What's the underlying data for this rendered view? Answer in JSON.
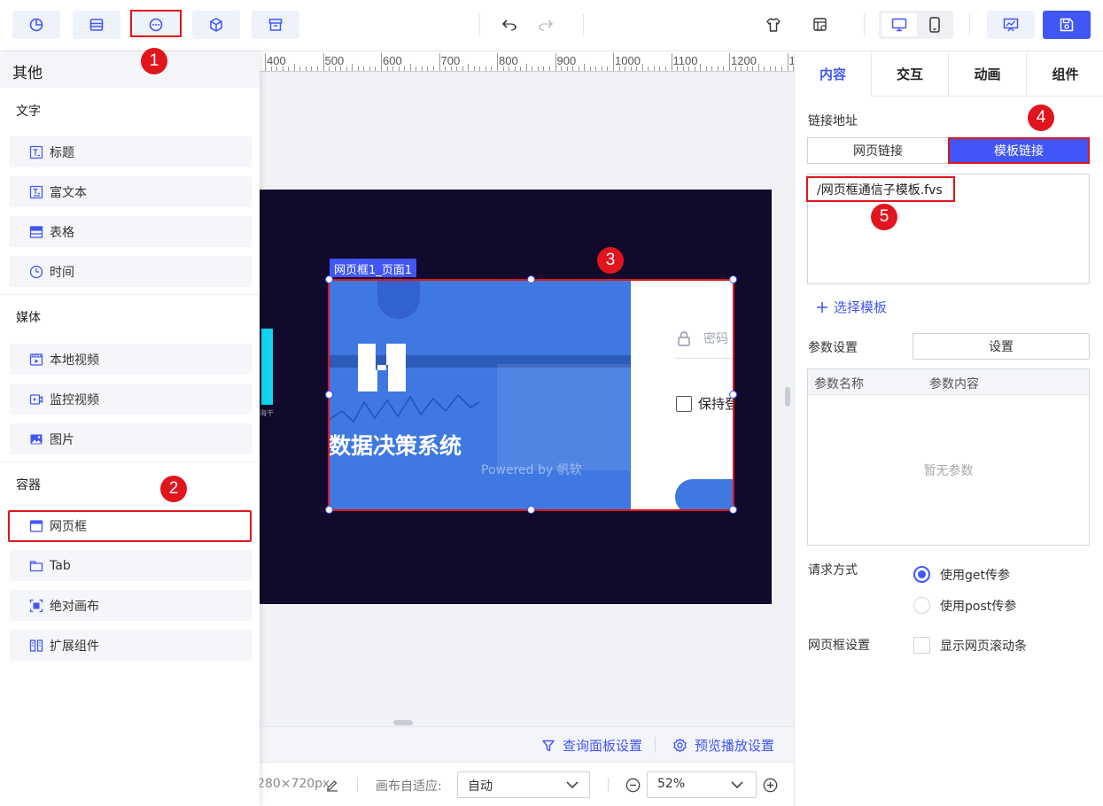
{
  "annotations": [
    "1",
    "2",
    "3",
    "4",
    "5"
  ],
  "left_panel": {
    "title": "其他",
    "sections": [
      {
        "title": "文字",
        "items": [
          "标题",
          "富文本",
          "表格",
          "时间"
        ]
      },
      {
        "title": "媒体",
        "items": [
          "本地视频",
          "监控视频",
          "图片"
        ]
      },
      {
        "title": "容器",
        "items": [
          "网页框",
          "Tab",
          "绝对画布",
          "扩展组件"
        ]
      }
    ]
  },
  "canvas": {
    "ruler_labels": [
      "400",
      "500",
      "600",
      "700",
      "800",
      "900",
      "1000",
      "1100",
      "1200",
      "1"
    ],
    "frame_tag": "网页框1_页面1",
    "embedded": {
      "system_title": "数据决策系统",
      "powered_by": "Powered by 帆软",
      "password_placeholder": "密码",
      "remember_label": "保持登",
      "chart_caption": "海干"
    }
  },
  "bottom": {
    "query_panel_settings": "查询面板设置",
    "preview_settings": "预览播放设置",
    "canvas_size": "280×720px",
    "fit_label": "画布自适应:",
    "fit_value": "自动",
    "zoom_value": "52%"
  },
  "right_panel": {
    "tabs": [
      "内容",
      "交互",
      "动画",
      "组件"
    ],
    "link_address_label": "链接地址",
    "link_types": [
      "网页链接",
      "模板链接"
    ],
    "active_link_type": "模板链接",
    "template_path": "/网页框通信子模板.fvs",
    "choose_template": "选择模板",
    "param_settings_label": "参数设置",
    "settings_button": "设置",
    "param_columns": [
      "参数名称",
      "参数内容"
    ],
    "no_params": "暂无参数",
    "request_method_label": "请求方式",
    "request_methods": [
      "使用get传参",
      "使用post传参"
    ],
    "selected_request_method": "使用get传参",
    "frame_settings_label": "网页框设置",
    "show_scrollbar_label": "显示网页滚动条",
    "show_scrollbar_checked": false
  },
  "colors": {
    "accent": "#4156f6",
    "annotation_red": "#e0151d",
    "dashboard_bg": "#110a2b",
    "frame_blue": "#3e78e0"
  }
}
